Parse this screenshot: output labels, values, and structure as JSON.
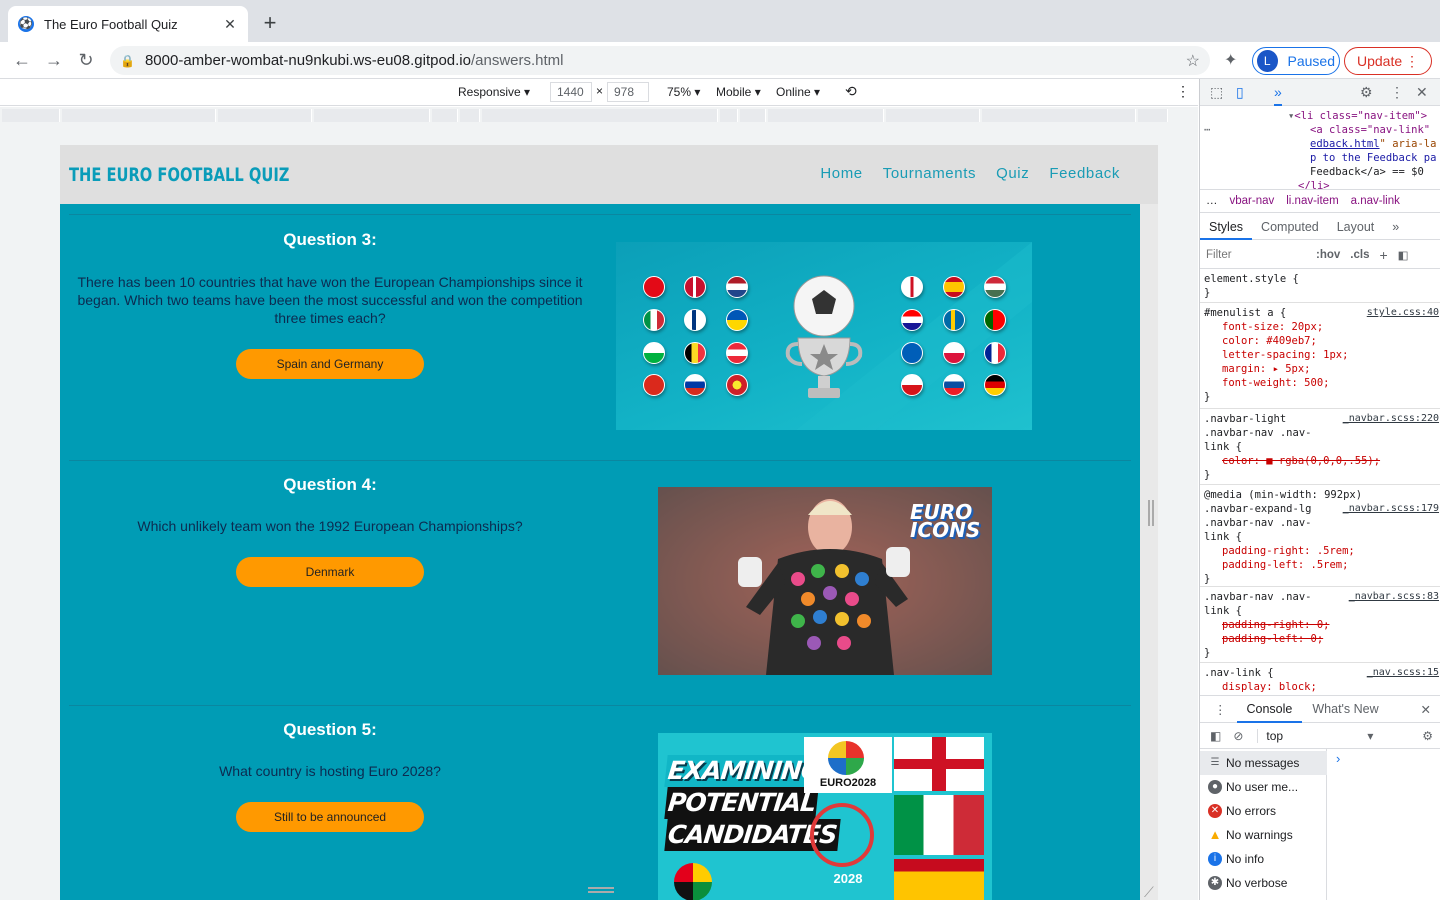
{
  "tab": {
    "title": "The Euro Football Quiz",
    "favicon": "soccer-ball-icon"
  },
  "address": {
    "host": "8000-amber-wombat-nu9nkubi.ws-eu08.gitpod.io",
    "path": "/answers.html"
  },
  "profile": {
    "initial": "L",
    "label": "Paused"
  },
  "update": {
    "label": "Update"
  },
  "device": {
    "mode": "Responsive",
    "width": "1440",
    "height": "978",
    "zoom": "75%",
    "throttle": "Mobile",
    "network": "Online"
  },
  "site": {
    "brand": "THE EURO FOOTBALL QUIZ",
    "menu": [
      "Home",
      "Tournaments",
      "Quiz",
      "Feedback"
    ],
    "questions": [
      {
        "title": "Question 3:",
        "text": "There has been 10 countries that have won the European Championships since it began. Which two teams have been the most successful and won the competition three times each?",
        "answer": "Spain and Germany"
      },
      {
        "title": "Question 4:",
        "text": "Which unlikely team won the 1992 European Championships?",
        "answer": "Denmark"
      },
      {
        "title": "Question 5:",
        "text": "What country is hosting Euro 2028?",
        "answer": "Still to be announced"
      }
    ],
    "image4_logo": "EURO ICONS",
    "image5": {
      "headline": [
        "EXAMINING",
        "POTENTIAL",
        "CANDIDATES"
      ],
      "logo": "EURO2028",
      "year": "2028"
    }
  },
  "colors": {
    "teal": "#009cb5",
    "orange": "#ff9900",
    "nav": "#409eb7"
  },
  "devtools": {
    "dom": {
      "l1_tag": "<li class=\"nav-item\">",
      "l2": "<a class=\"nav-link\"",
      "l3_link": "edback.html",
      "l3_rest": "\" aria-la",
      "l4": "p to the Feedback pa",
      "l5": "Feedback</a> == $0",
      "l6": "</li>"
    },
    "crumbs": [
      "vbar-nav",
      "li.nav-item",
      "a.nav-link"
    ],
    "tabs": [
      "Styles",
      "Computed",
      "Layout"
    ],
    "filter": {
      "placeholder": "Filter",
      "hov": ":hov",
      "cls": ".cls"
    },
    "rules": {
      "r0": {
        "sel": "element.style {",
        "close": "}"
      },
      "r1": {
        "sel": "#menulist a {",
        "src": "style.css:40",
        "p1": "font-size: 20px;",
        "p2": "color: #409eb7;",
        "p3": "letter-spacing: 1px;",
        "p4": "margin: ▸ 5px;",
        "p5": "font-weight: 500;"
      },
      "r2": {
        "sel1": ".navbar-light",
        "sel2": ".navbar-nav .nav-",
        "sel3": "link {",
        "src": "_navbar.scss:220",
        "p1": "color: ■ rgba(0,0,0,.55);"
      },
      "r3": {
        "sel0": "@media (min-width: 992px)",
        "sel1": ".navbar-expand-lg",
        "sel2": ".navbar-nav .nav-",
        "sel3": "link {",
        "src": "_navbar.scss:179",
        "p1": "padding-right: .5rem;",
        "p2": "padding-left: .5rem;"
      },
      "r4": {
        "sel1": ".navbar-nav .nav-",
        "sel2": "link {",
        "src": "_navbar.scss:83",
        "p1": "padding-right: 0;",
        "p2": "padding-left: 0;"
      },
      "r5": {
        "sel": ".nav-link {",
        "src": "_nav.scss:15",
        "p1": "display: block;"
      }
    },
    "console_tabs": [
      "Console",
      "What's New"
    ],
    "context": "top",
    "messages": [
      "No messages",
      "No user me...",
      "No errors",
      "No warnings",
      "No info",
      "No verbose"
    ]
  }
}
